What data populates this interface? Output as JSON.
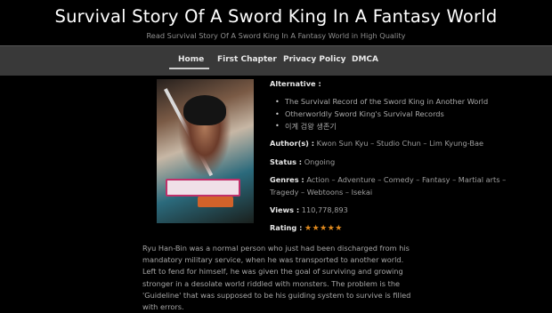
{
  "site": {
    "title": "Survival Story Of A Sword King In A Fantasy World",
    "tagline": "Read Survival Story Of A Sword King In A Fantasy World in High Quality"
  },
  "nav": {
    "items": [
      "Home",
      "First Chapter",
      "Privacy Policy",
      "DMCA"
    ],
    "active": "Home"
  },
  "manga": {
    "alternative_label": "Alternative :",
    "alternatives": [
      "The Survival Record of the Sword King in Another World",
      "Otherworldly Sword King's Survival Records",
      "이계 검왕 생존기"
    ],
    "authors_label": "Author(s) :",
    "authors": "Kwon Sun Kyu – Studio Chun – Lim Kyung-Bae",
    "status_label": "Status :",
    "status": "Ongoing",
    "genres_label": "Genres :",
    "genres_line1": "Action – Adventure – Comedy – Fantasy – Martial arts –",
    "genres_line2": "Tragedy – Webtoons – Isekai",
    "views_label": "Views :",
    "views": "110,778,893",
    "rating_label": "Rating :",
    "rating": 5,
    "rating_max": 5,
    "star_color": "#e08a1e"
  },
  "synopsis": "Ryu Han-Bin was a normal person who just had been discharged from his mandatory military service, when he was transported to another world. Left to fend for himself, he was given the goal of surviving and growing stronger in a desolate world riddled with monsters. The problem is the 'Guideline' that was supposed to be his guiding system to survive is filled with errors."
}
